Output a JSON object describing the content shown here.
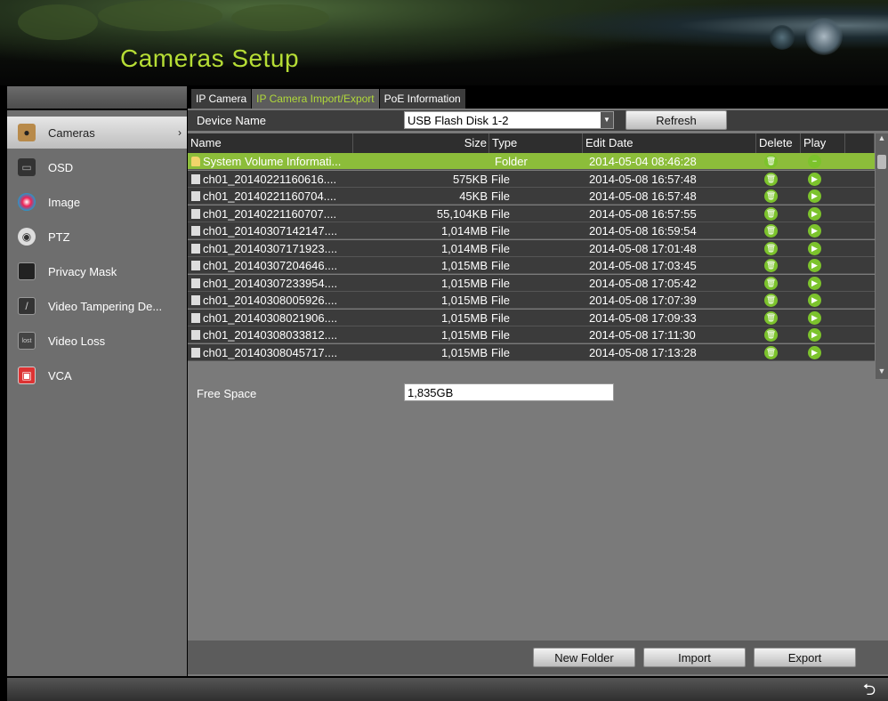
{
  "header": {
    "title": "Cameras Setup"
  },
  "sidebar": {
    "items": [
      {
        "label": "Cameras",
        "active": true
      },
      {
        "label": "OSD"
      },
      {
        "label": "Image"
      },
      {
        "label": "PTZ"
      },
      {
        "label": "Privacy Mask"
      },
      {
        "label": "Video Tampering De..."
      },
      {
        "label": "Video Loss"
      },
      {
        "label": "VCA"
      }
    ]
  },
  "tabs": [
    "IP Camera",
    "IP Camera Import/Export",
    "PoE Information"
  ],
  "active_tab": "IP Camera Import/Export",
  "device": {
    "label": "Device Name",
    "value": "USB Flash Disk 1-2",
    "refresh_label": "Refresh"
  },
  "table": {
    "headers": {
      "name": "Name",
      "size": "Size",
      "type": "Type",
      "edit_date": "Edit Date",
      "delete": "Delete",
      "play": "Play"
    },
    "rows": [
      {
        "name": "System Volume Informati...",
        "size": "",
        "type": "Folder",
        "edit_date": "2014-05-04 08:46:28",
        "kind": "folder",
        "selected": true
      },
      {
        "name": "ch01_20140221160616....",
        "size": "575KB",
        "type": "File",
        "edit_date": "2014-05-08 16:57:48",
        "kind": "file"
      },
      {
        "name": "ch01_20140221160704....",
        "size": "45KB",
        "type": "File",
        "edit_date": "2014-05-08 16:57:48",
        "kind": "file"
      },
      {
        "name": "ch01_20140221160707....",
        "size": "55,104KB",
        "type": "File",
        "edit_date": "2014-05-08 16:57:55",
        "kind": "file"
      },
      {
        "name": "ch01_20140307142147....",
        "size": "1,014MB",
        "type": "File",
        "edit_date": "2014-05-08 16:59:54",
        "kind": "file"
      },
      {
        "name": "ch01_20140307171923....",
        "size": "1,014MB",
        "type": "File",
        "edit_date": "2014-05-08 17:01:48",
        "kind": "file"
      },
      {
        "name": "ch01_20140307204646....",
        "size": "1,015MB",
        "type": "File",
        "edit_date": "2014-05-08 17:03:45",
        "kind": "file"
      },
      {
        "name": "ch01_20140307233954....",
        "size": "1,015MB",
        "type": "File",
        "edit_date": "2014-05-08 17:05:42",
        "kind": "file"
      },
      {
        "name": "ch01_20140308005926....",
        "size": "1,015MB",
        "type": "File",
        "edit_date": "2014-05-08 17:07:39",
        "kind": "file"
      },
      {
        "name": "ch01_20140308021906....",
        "size": "1,015MB",
        "type": "File",
        "edit_date": "2014-05-08 17:09:33",
        "kind": "file"
      },
      {
        "name": "ch01_20140308033812....",
        "size": "1,015MB",
        "type": "File",
        "edit_date": "2014-05-08 17:11:30",
        "kind": "file"
      },
      {
        "name": "ch01_20140308045717....",
        "size": "1,015MB",
        "type": "File",
        "edit_date": "2014-05-08 17:13:28",
        "kind": "file"
      }
    ]
  },
  "free_space": {
    "label": "Free Space",
    "value": "1,835GB"
  },
  "actions": {
    "new_folder": "New Folder",
    "import": "Import",
    "export": "Export"
  },
  "colors": {
    "accent": "#b0d83a",
    "selected_row": "#8cbd3a",
    "icon_green": "#7cc32c"
  },
  "icons": {
    "sidebar": [
      "camera-icon",
      "osd-icon",
      "image-icon",
      "ptz-icon",
      "privacy-mask-icon",
      "video-tampering-icon",
      "video-loss-icon",
      "vca-icon"
    ],
    "back": "back-arrow-icon"
  }
}
